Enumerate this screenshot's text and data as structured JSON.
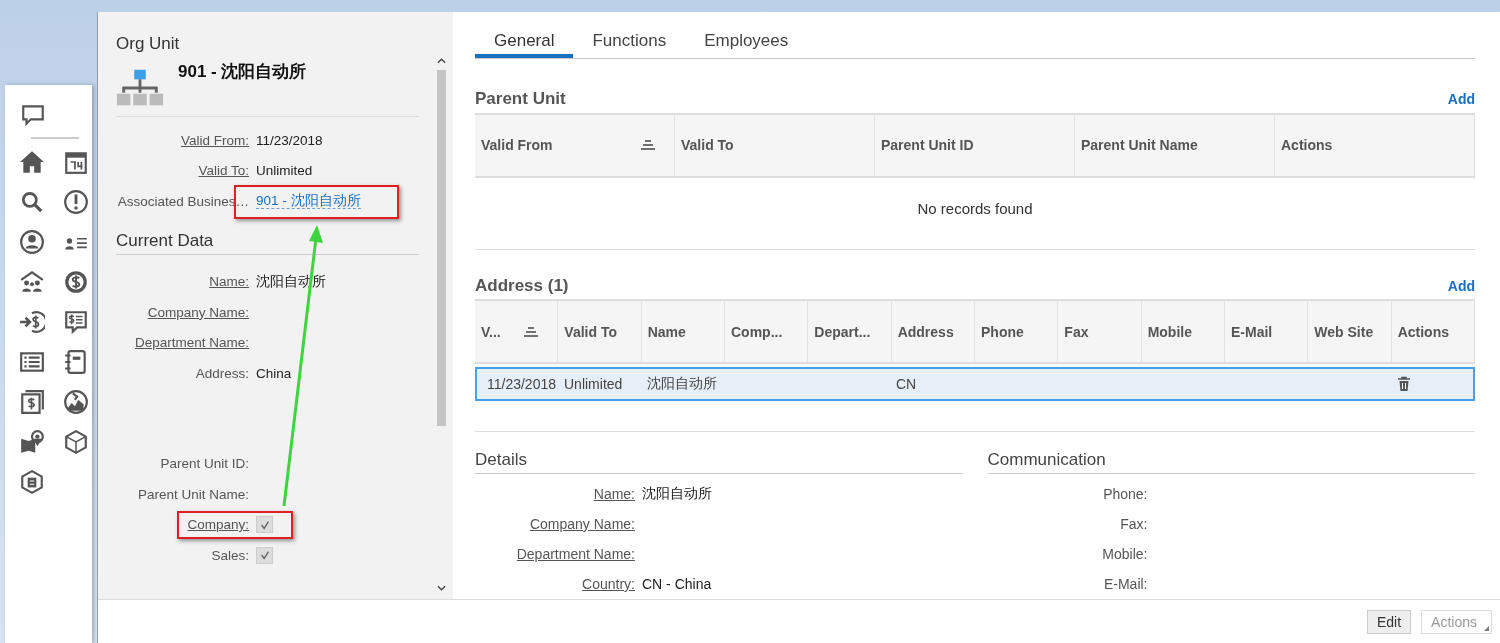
{
  "left_panel": {
    "title": "Org Unit",
    "unit_name": "901 - 沈阳自动所",
    "annotation_arrow": true,
    "header_fields": [
      {
        "label": "Valid From:",
        "label_link": true,
        "value": "11/23/2018",
        "kind": "text"
      },
      {
        "label": "Valid To:",
        "label_link": true,
        "value": "Unlimited",
        "kind": "text"
      },
      {
        "label": "Associated Busines…",
        "label_link": false,
        "value": "901 - 沈阳自动所",
        "kind": "link",
        "highlighted": true
      }
    ],
    "current_data": {
      "title": "Current Data",
      "field_groups": [
        {
          "fields": [
            {
              "label": "Name:",
              "label_link": true,
              "value": "沈阳自动所",
              "kind": "text"
            },
            {
              "label": "Company Name:",
              "label_link": true,
              "kind": "text"
            },
            {
              "label": "Department Name:",
              "label_link": true,
              "kind": "text"
            },
            {
              "label": "Address:",
              "label_link": false,
              "value": "China",
              "kind": "text"
            }
          ]
        },
        {
          "fields": [
            {
              "label": "Parent Unit ID:",
              "label_link": false,
              "kind": "text"
            },
            {
              "label": "Parent Unit Name:",
              "label_link": false,
              "kind": "text"
            },
            {
              "label": "Company:",
              "label_link": true,
              "kind": "checkbox",
              "checked": true,
              "highlighted": true
            },
            {
              "label": "Sales:",
              "label_link": false,
              "kind": "checkbox",
              "checked": true
            }
          ]
        }
      ]
    }
  },
  "tabs": [
    {
      "label": "General",
      "selected": true
    },
    {
      "label": "Functions",
      "selected": false
    },
    {
      "label": "Employees",
      "selected": false
    }
  ],
  "parent_unit": {
    "title": "Parent Unit",
    "add_label": "Add",
    "columns": [
      {
        "label": "Valid From",
        "sorted": true
      },
      {
        "label": "Valid To",
        "sorted": false
      },
      {
        "label": "Parent Unit ID",
        "sorted": false
      },
      {
        "label": "Parent Unit Name",
        "sorted": false
      },
      {
        "label": "Actions",
        "sorted": false
      }
    ],
    "empty_message": "No records found"
  },
  "address": {
    "title": "Address (1)",
    "add_label": "Add",
    "columns": [
      {
        "label": "V...",
        "sorted": true
      },
      {
        "label": "Valid To",
        "sorted": false
      },
      {
        "label": "Name",
        "sorted": false
      },
      {
        "label": "Comp...",
        "sorted": false
      },
      {
        "label": "Depart...",
        "sorted": false
      },
      {
        "label": "Address",
        "sorted": false
      },
      {
        "label": "Phone",
        "sorted": false
      },
      {
        "label": "Fax",
        "sorted": false
      },
      {
        "label": "Mobile",
        "sorted": false
      },
      {
        "label": "E-Mail",
        "sorted": false
      },
      {
        "label": "Web Site",
        "sorted": false
      },
      {
        "label": "Actions",
        "sorted": false
      }
    ],
    "rows": [
      {
        "selected": true,
        "cells": [
          "11/23/2018",
          "Unlimited",
          "沈阳自动所",
          null,
          null,
          "CN",
          null,
          null,
          null,
          null,
          null
        ],
        "actions": [
          {
            "kind": "delete"
          }
        ]
      }
    ]
  },
  "details": {
    "title": "Details",
    "fields": [
      {
        "label": "Name:",
        "label_link": true,
        "value": "沈阳自动所"
      },
      {
        "label": "Company Name:",
        "label_link": true
      },
      {
        "label": "Department Name:",
        "label_link": true
      },
      {
        "label": "Country:",
        "label_link": true,
        "value": "CN - China"
      }
    ]
  },
  "communication": {
    "title": "Communication",
    "fields": [
      {
        "label": "Phone:",
        "label_link": false
      },
      {
        "label": "Fax:",
        "label_link": false
      },
      {
        "label": "Mobile:",
        "label_link": false
      },
      {
        "label": "E-Mail:",
        "label_link": false
      }
    ]
  },
  "footer_buttons": [
    {
      "label": "Edit",
      "kind": "button",
      "disabled": false
    },
    {
      "label": "Actions",
      "kind": "menu",
      "disabled": true
    }
  ]
}
